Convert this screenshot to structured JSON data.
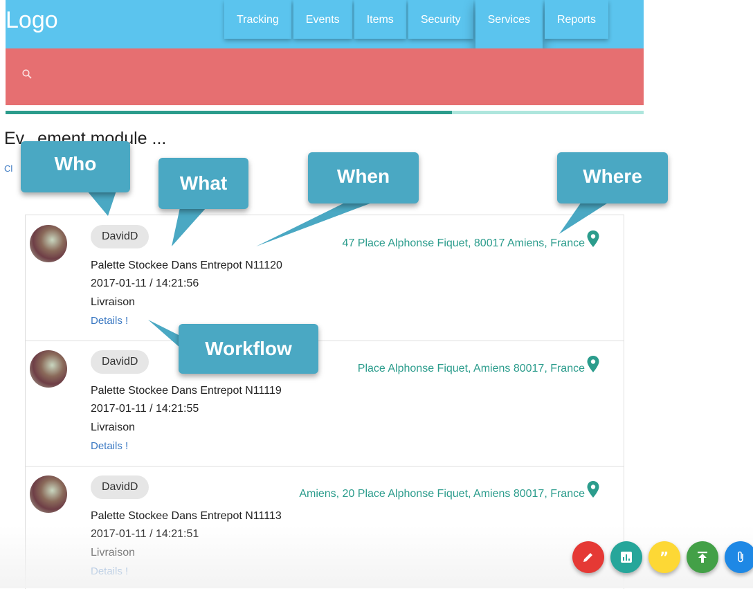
{
  "header": {
    "logo": "Logo",
    "nav": [
      "Tracking",
      "Events",
      "Items",
      "Security",
      "Services",
      "Reports"
    ]
  },
  "search": {
    "placeholder": ""
  },
  "progress": {
    "percent": 70
  },
  "page": {
    "title": "Ev...ement module ...",
    "subtitle": "Cl"
  },
  "callouts": {
    "who": "Who",
    "what": "What",
    "when": "When",
    "where": "Where",
    "workflow": "Workflow"
  },
  "events": [
    {
      "user": "DavidD",
      "address": "47 Place Alphonse Fiquet, 80017 Amiens, France",
      "title": "Palette Stockee Dans Entrepot N11120",
      "datetime": "2017-01-11 / 14:21:56",
      "type": "Livraison",
      "details": "Details !"
    },
    {
      "user": "DavidD",
      "address": "Place Alphonse Fiquet, Amiens 80017, France",
      "title": "Palette Stockee Dans Entrepot N11119",
      "datetime": "2017-01-11 / 14:21:55",
      "type": "Livraison",
      "details": "Details !"
    },
    {
      "user": "DavidD",
      "address": "Amiens, 20 Place Alphonse Fiquet, Amiens 80017, France",
      "title": "Palette Stockee Dans Entrepot N11113",
      "datetime": "2017-01-11 / 14:21:51",
      "type": "Livraison",
      "details": "Details !"
    }
  ],
  "colors": {
    "header": "#5bc4ee",
    "search": "#e66f71",
    "teal": "#2b9c8c",
    "callout": "#4aa8c3",
    "fab_red": "#e53935",
    "fab_teal": "#26a69a",
    "fab_yellow": "#fdd835",
    "fab_green": "#43a047",
    "fab_blue": "#1e88e5"
  },
  "fabs": [
    "edit-icon",
    "chart-icon",
    "quote-icon",
    "upload-icon",
    "attachment-icon"
  ]
}
